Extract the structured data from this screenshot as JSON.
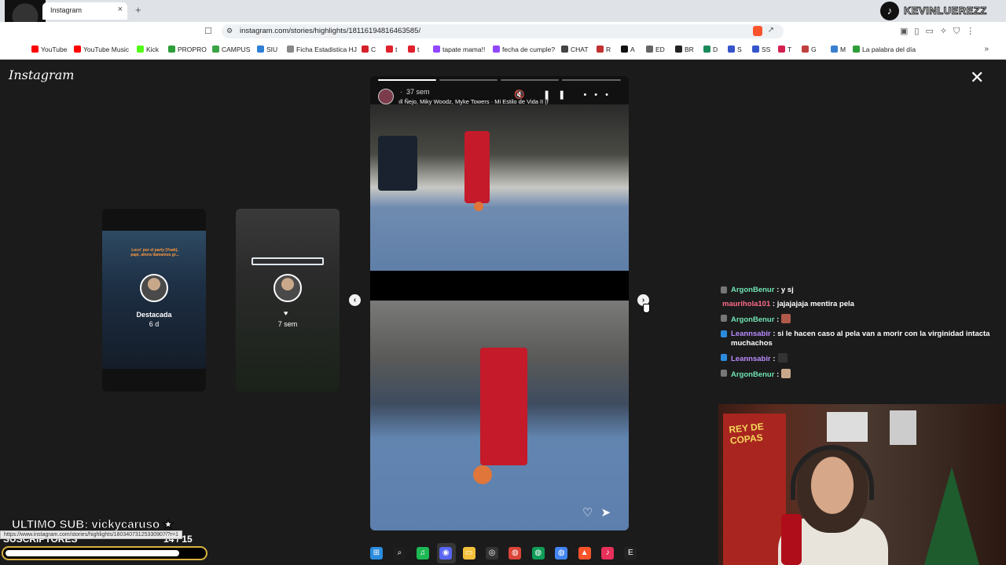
{
  "browser": {
    "tab_title": "Instagram",
    "tab_close": "×",
    "new_tab": "+",
    "url": "instagram.com/stories/highlights/18116194816463585/",
    "status_url": "https://www.instagram.com/stories/highlights/18034073125330907/?r=1",
    "bookmarks": [
      {
        "label": "YouTube",
        "color": "#ff0000"
      },
      {
        "label": "YouTube Music",
        "color": "#ff0000"
      },
      {
        "label": "Kick",
        "color": "#53fc18"
      },
      {
        "label": "PROPRO",
        "color": "#2e9e3a"
      },
      {
        "label": "CAMPUS",
        "color": "#3aa346"
      },
      {
        "label": "SIU",
        "color": "#2e7fd6"
      },
      {
        "label": "Ficha Estadistica HJ",
        "color": "#888888"
      },
      {
        "label": "C",
        "color": "#d4202a"
      },
      {
        "label": "t",
        "color": "#e0202a"
      },
      {
        "label": "t",
        "color": "#e0202a"
      },
      {
        "label": "tapate mama!!",
        "color": "#9146ff"
      },
      {
        "label": "fecha de cumple?",
        "color": "#9146ff"
      },
      {
        "label": "CHAT",
        "color": "#444444"
      },
      {
        "label": "R",
        "color": "#c23030"
      },
      {
        "label": "A",
        "color": "#111111"
      },
      {
        "label": "ED",
        "color": "#666666"
      },
      {
        "label": "BR",
        "color": "#222222"
      },
      {
        "label": "D",
        "color": "#1a8a5a"
      },
      {
        "label": "S",
        "color": "#3555c8"
      },
      {
        "label": "SS",
        "color": "#3555c8"
      },
      {
        "label": "T",
        "color": "#d42050"
      },
      {
        "label": "G",
        "color": "#c04040"
      },
      {
        "label": "M",
        "color": "#3a7fd0"
      },
      {
        "label": "La palabra del día",
        "color": "#2e9e3a"
      }
    ],
    "more": "»"
  },
  "tiktok": {
    "handle": "KEVINLUEREZZ"
  },
  "instagram": {
    "logo": "Instagram",
    "close": "✕",
    "previews": [
      {
        "title": "Destacada",
        "sub": "6 d",
        "overtext": "Loco' por el party (Yeah), papi, ahora llamamos gr..."
      },
      {
        "title": "",
        "sub": "7 sem",
        "heart": "♥"
      }
    ],
    "story": {
      "time": "37 sem",
      "song": "Ñejo, Miky Woodz, Myke Towers · Mi Estilo de Vida II (f",
      "dot": "·",
      "controls": "🔇 ❚❚ •••",
      "like": "♡",
      "share": "➤"
    },
    "nav_prev": "‹",
    "nav_next": "›"
  },
  "chat": [
    {
      "user": "ArgonBenur",
      "user_color": "#6fe3b4",
      "text": ": y sj",
      "badge": "#777777",
      "emote": ""
    },
    {
      "user": "maurihola101",
      "user_color": "#ff6b8a",
      "text": ": jajajajaja mentira pela",
      "badge": "",
      "emote": ""
    },
    {
      "user": "ArgonBenur",
      "user_color": "#6fe3b4",
      "text": ":",
      "badge": "#777777",
      "emote": "#b05a4a"
    },
    {
      "user": "Leannsabir",
      "user_color": "#b98cff",
      "text": ": si le hacen caso al pela van a morir con la virginidad intacta muchachos",
      "badge": "#2b8cdd",
      "emote": ""
    },
    {
      "user": "Leannsabir",
      "user_color": "#b98cff",
      "text": ":",
      "badge": "#2b8cdd",
      "emote": "#333333"
    },
    {
      "user": "ArgonBenur",
      "user_color": "#6fe3b4",
      "text": ":",
      "badge": "#777777",
      "emote": "#c9a88a"
    }
  ],
  "overlay": {
    "last_sub": "ULTIMO SUB: vickycaruso ★",
    "subs_label": "SUSCRIPTORES",
    "subs_count": "14 / 15",
    "subs_progress": 0.93
  },
  "webcam": {
    "banner_text": "REY DE COPAS"
  },
  "taskbar": [
    {
      "name": "windows-start-icon",
      "color": "#2b8cdd",
      "glyph": "⊞"
    },
    {
      "name": "search-icon",
      "color": "#1e1e1e",
      "glyph": "⌕"
    },
    {
      "name": "spotify-icon",
      "color": "#1db954",
      "glyph": "♫"
    },
    {
      "name": "discord-icon",
      "color": "#5865f2",
      "glyph": "◉"
    },
    {
      "name": "file-explorer-icon",
      "color": "#f3c13a",
      "glyph": "▭"
    },
    {
      "name": "obs-icon",
      "color": "#333333",
      "glyph": "◎"
    },
    {
      "name": "chrome-icon",
      "color": "#db4437",
      "glyph": "◍"
    },
    {
      "name": "chrome-profile-icon",
      "color": "#0f9d58",
      "glyph": "◍"
    },
    {
      "name": "chrome-profile2-icon",
      "color": "#4285f4",
      "glyph": "◍"
    },
    {
      "name": "brave-icon",
      "color": "#fb542b",
      "glyph": "▲"
    },
    {
      "name": "tiktok-icon",
      "color": "#e8305a",
      "glyph": "♪"
    },
    {
      "name": "epic-games-icon",
      "color": "#222222",
      "glyph": "E"
    }
  ]
}
